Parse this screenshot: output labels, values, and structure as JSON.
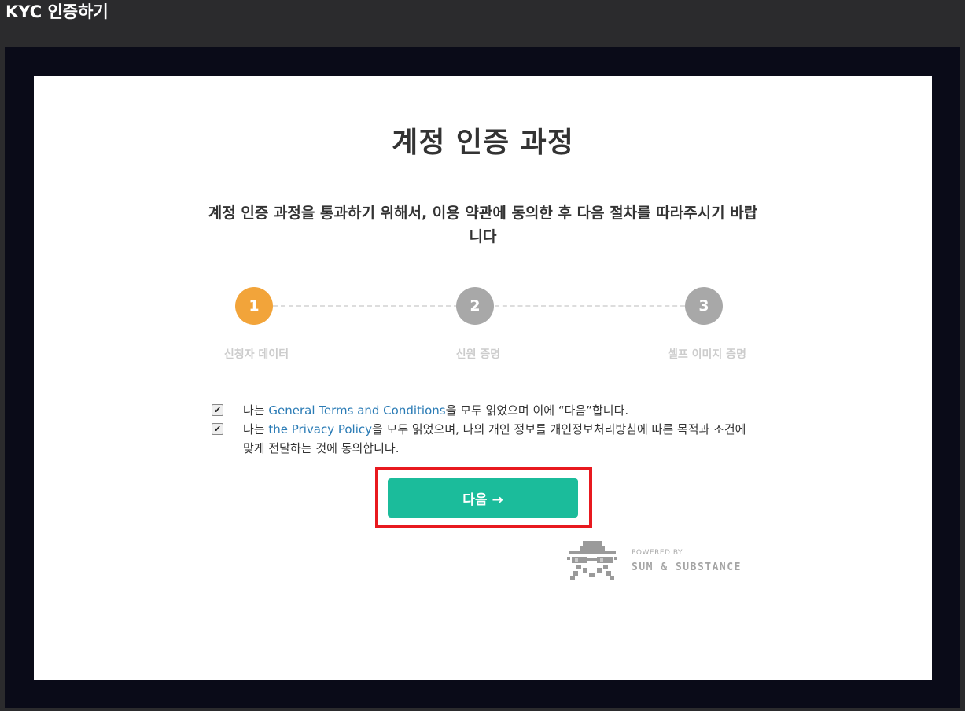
{
  "window": {
    "title": "KYC 인증하기"
  },
  "page": {
    "heading": "계정 인증 과정",
    "subtitle": "계정 인증 과정을 통과하기 위해서, 이용 약관에 동의한 후 다음 절차를 따라주시기 바랍니다"
  },
  "steps": [
    {
      "number": "1",
      "label": "신청자 데이터",
      "active": true
    },
    {
      "number": "2",
      "label": "신원 증명",
      "active": false
    },
    {
      "number": "3",
      "label": "셀프 이미지 증명",
      "active": false
    }
  ],
  "colors": {
    "active_step": "#f2a43a",
    "inactive_step": "#a8a8a8",
    "button": "#1bbc9b",
    "highlight": "#e8191f",
    "link": "#2a7bb5"
  },
  "agreements": {
    "terms": {
      "checked": true,
      "prefix": "나는 ",
      "link": "General Terms and Conditions",
      "suffix": "을 모두 읽었으며 이에 “다음”합니다."
    },
    "privacy": {
      "checked": true,
      "prefix": "나는 ",
      "link": "the Privacy Policy",
      "suffix": "을 모두 읽었으며, 나의 개인 정보를 개인정보처리방침에 따른 목적과 조건에 맞게 전달하는 것에 동의합니다."
    }
  },
  "next_button": {
    "label": "다음 →"
  },
  "powered_by": {
    "small": "POWERED BY",
    "brand": "SUM & SUBSTANCE",
    "logo_icon": "sumsub-spy-logo-icon"
  }
}
